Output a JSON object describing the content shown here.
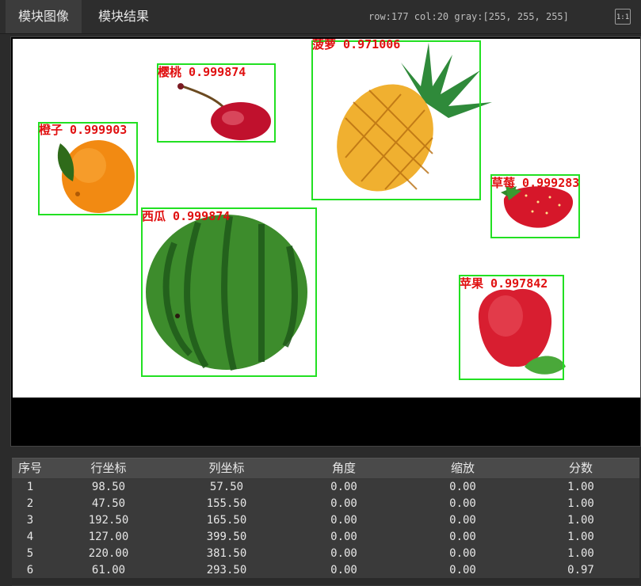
{
  "tabs": [
    {
      "label": "模块图像"
    },
    {
      "label": "模块结果"
    }
  ],
  "pixel_info": "row:177 col:20 gray:[255, 255, 255]",
  "fit_label": "1:1",
  "detections": [
    {
      "name": "橙子",
      "score": "0.999903"
    },
    {
      "name": "樱桃",
      "score": "0.999874"
    },
    {
      "name": "菠萝",
      "score": "0.971006"
    },
    {
      "name": "草莓",
      "score": "0.999283"
    },
    {
      "name": "西瓜",
      "score": "0.999874"
    },
    {
      "name": "苹果",
      "score": "0.997842"
    }
  ],
  "table": {
    "headers": [
      "序号",
      "行坐标",
      "列坐标",
      "角度",
      "缩放",
      "分数"
    ],
    "rows": [
      [
        "1",
        "98.50",
        "57.50",
        "0.00",
        "0.00",
        "1.00"
      ],
      [
        "2",
        "47.50",
        "155.50",
        "0.00",
        "0.00",
        "1.00"
      ],
      [
        "3",
        "192.50",
        "165.50",
        "0.00",
        "0.00",
        "1.00"
      ],
      [
        "4",
        "127.00",
        "399.50",
        "0.00",
        "0.00",
        "1.00"
      ],
      [
        "5",
        "220.00",
        "381.50",
        "0.00",
        "0.00",
        "1.00"
      ],
      [
        "6",
        "61.00",
        "293.50",
        "0.00",
        "0.00",
        "0.97"
      ]
    ]
  },
  "colors": {
    "box": "#22e022",
    "label": "#e01010"
  }
}
